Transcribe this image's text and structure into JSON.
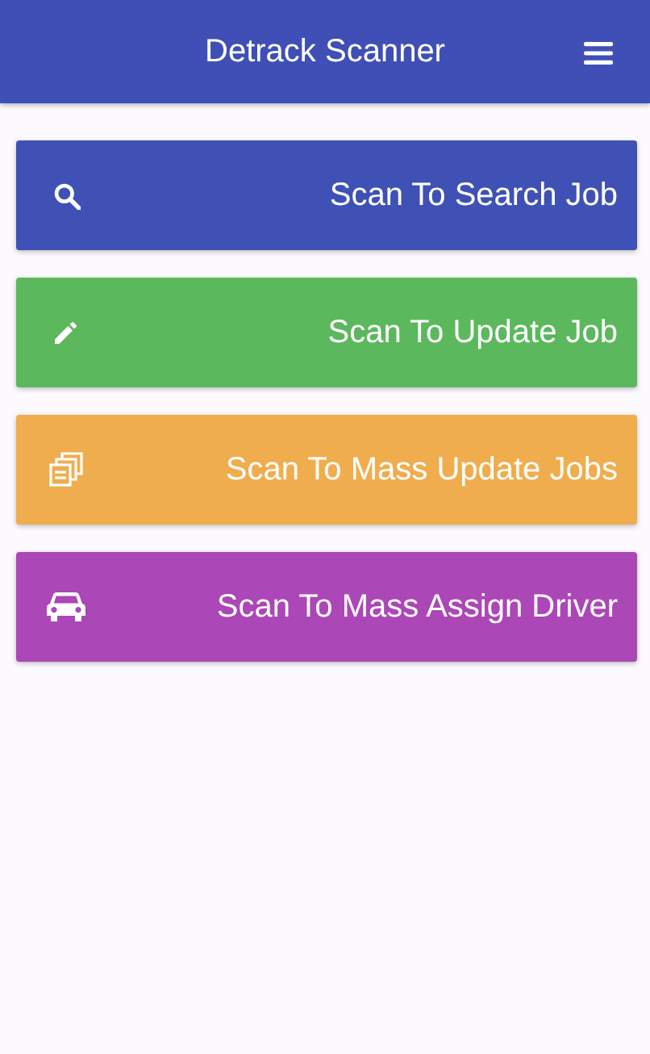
{
  "header": {
    "title": "Detrack Scanner"
  },
  "actions": [
    {
      "label": "Scan To Search Job",
      "kind": "search",
      "color": "#3f51b5"
    },
    {
      "label": "Scan To Update Job",
      "kind": "edit",
      "color": "#5cb85c"
    },
    {
      "label": "Scan To Mass Update Jobs",
      "kind": "copies",
      "color": "#f0ad4e"
    },
    {
      "label": "Scan To Mass Assign Driver",
      "kind": "car",
      "color": "#ab47b6"
    }
  ]
}
